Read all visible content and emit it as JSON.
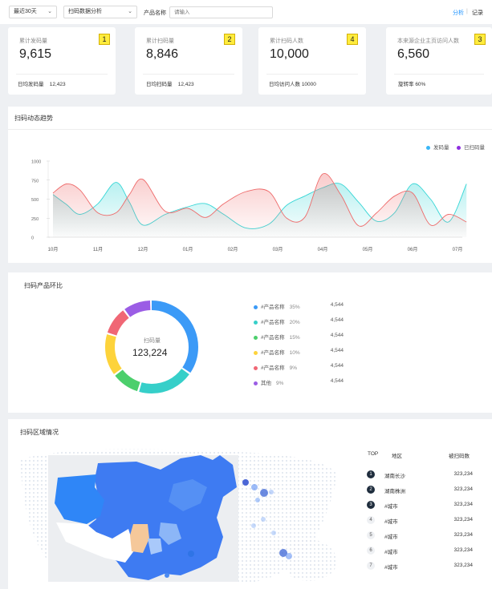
{
  "filters": {
    "range": "最近30天",
    "analysis": "扫码数据分析",
    "product_label": "产品名称",
    "product_placeholder": "请输入",
    "analysis_link": "分析",
    "separator": "|",
    "record_link": "记录"
  },
  "cards": [
    {
      "title": "累计发码量",
      "value": "9,615",
      "foot_label": "日均发码量",
      "foot_value": "12,423",
      "badge": "1"
    },
    {
      "title": "累计扫码量",
      "value": "8,846",
      "foot_label": "日均扫码量",
      "foot_value": "12,423",
      "badge": "2"
    },
    {
      "title": "累计扫码人数",
      "value": "10,000",
      "foot_label": "日均访问人数",
      "foot_value": "10000",
      "badge": "4"
    },
    {
      "title": "本来源企业主页访问人数",
      "value": "6,560",
      "foot_label": "旋转率",
      "foot_value": "60%",
      "badge": "3"
    }
  ],
  "trend": {
    "title": "扫码动态趋势",
    "legend": [
      {
        "name": "发码量",
        "color": "#3ab7f7"
      },
      {
        "name": "已扫码量",
        "color": "#8e2ee0"
      }
    ]
  },
  "chart_data": {
    "type": "area",
    "x": [
      "10月",
      "11月",
      "12月",
      "01月",
      "02月",
      "03月",
      "04月",
      "05月",
      "06月",
      "07月"
    ],
    "ylim": [
      0,
      1000
    ],
    "yticks": [
      0,
      250,
      500,
      750,
      1000
    ],
    "series": [
      {
        "name": "发码量",
        "color": "#36d6d6",
        "x": [
          0,
          0.3,
          0.6,
          1,
          1.4,
          1.7,
          2,
          2.5,
          3,
          3.4,
          3.8,
          4.3,
          4.8,
          5.2,
          5.6,
          6,
          6.4,
          6.8,
          7.2,
          7.6,
          8,
          8.4,
          8.8,
          9.2
        ],
        "values": [
          560,
          430,
          300,
          440,
          720,
          460,
          160,
          300,
          400,
          440,
          300,
          120,
          170,
          420,
          540,
          650,
          700,
          460,
          210,
          320,
          700,
          500,
          200,
          700
        ]
      },
      {
        "name": "已扫码量",
        "color": "#ee6a6a",
        "x": [
          0,
          0.3,
          0.6,
          1,
          1.4,
          1.7,
          2,
          2.5,
          3,
          3.4,
          3.8,
          4.3,
          4.8,
          5.2,
          5.6,
          6,
          6.4,
          6.8,
          7.2,
          7.6,
          8,
          8.4,
          8.8,
          9.2
        ],
        "values": [
          580,
          700,
          620,
          320,
          320,
          560,
          760,
          340,
          380,
          260,
          440,
          600,
          600,
          250,
          260,
          830,
          560,
          150,
          320,
          540,
          580,
          160,
          300,
          200
        ]
      }
    ]
  },
  "donut": {
    "title": "扫码产品环比",
    "center_label": "扫码量",
    "center_value": "123,224",
    "items": [
      {
        "name": "#产品名称",
        "pct": "35%",
        "value": "4,544",
        "color": "#3b9af7",
        "frac": 0.35
      },
      {
        "name": "#产品名称",
        "pct": "20%",
        "value": "4,544",
        "color": "#36cfc9",
        "frac": 0.2
      },
      {
        "name": "#产品名称",
        "pct": "15%",
        "value": "4,544",
        "color": "#4ccf6c",
        "frac": 0.1
      },
      {
        "name": "#产品名称",
        "pct": "10%",
        "value": "4,544",
        "color": "#fdd33b",
        "frac": 0.15
      },
      {
        "name": "#产品名称",
        "pct": "9%",
        "value": "4,544",
        "color": "#f06775",
        "frac": 0.1
      },
      {
        "name": "其他",
        "pct": "9%",
        "value": "4,544",
        "color": "#9b5de5",
        "frac": 0.1
      }
    ]
  },
  "region": {
    "title": "扫码区域情况",
    "headers": [
      "TOP",
      "地区",
      "被扫码数"
    ],
    "rows": [
      {
        "rank": "1",
        "region": "湖南长沙",
        "count": "323,234"
      },
      {
        "rank": "2",
        "region": "湖南株洲",
        "count": "323,234"
      },
      {
        "rank": "3",
        "region": "#城市",
        "count": "323,234"
      },
      {
        "rank": "4",
        "region": "#城市",
        "count": "323,234"
      },
      {
        "rank": "5",
        "region": "#城市",
        "count": "323,234"
      },
      {
        "rank": "6",
        "region": "#城市",
        "count": "323,234"
      },
      {
        "rank": "7",
        "region": "#城市",
        "count": "323,234"
      }
    ]
  }
}
